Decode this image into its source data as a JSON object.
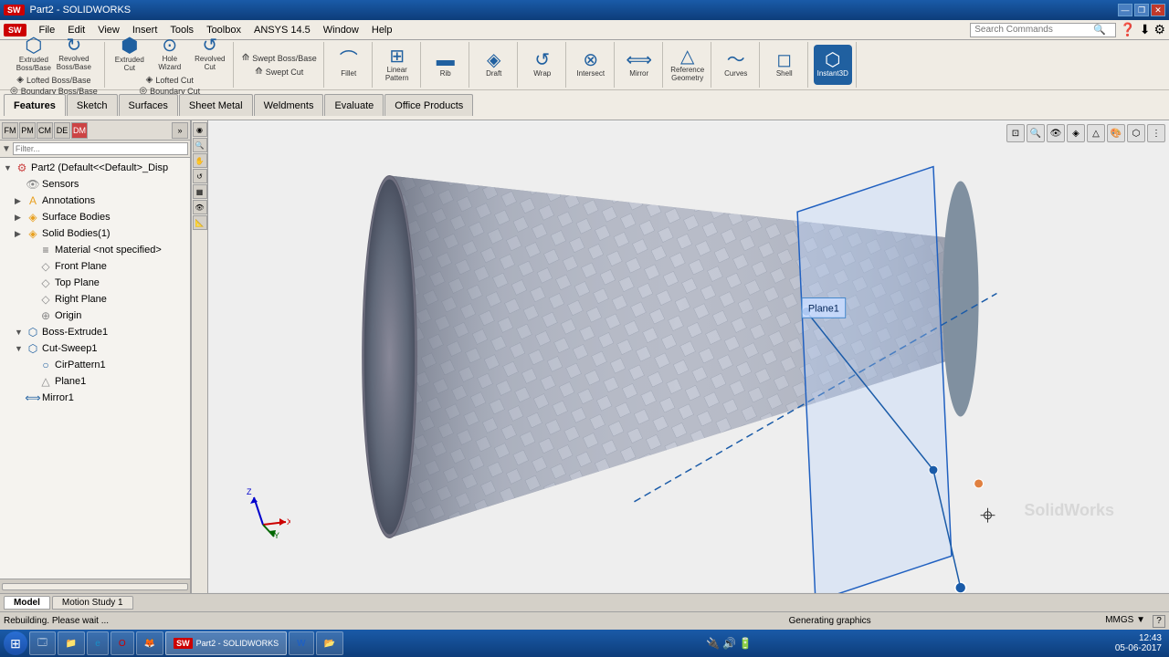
{
  "app": {
    "title": "Part2 - SOLIDWORKS",
    "logo": "SW"
  },
  "titlebar": {
    "title": "Part2 - SOLIDWORKS",
    "minimize": "—",
    "restore": "❐",
    "close": "✕"
  },
  "menubar": {
    "items": [
      "File",
      "Edit",
      "View",
      "Insert",
      "Tools",
      "Toolbox",
      "ANSYS 14.5",
      "Window",
      "Help"
    ],
    "search_placeholder": "Search Commands"
  },
  "toolbar": {
    "row1_groups": [
      {
        "name": "Extruded Boss/Base",
        "icon": "⬡",
        "sub_items": [
          "Revolved Boss/Base",
          "Lofted Boss/Base",
          "Boundary Boss/Base"
        ]
      },
      {
        "name": "Extruded Cut",
        "icon": "⬡",
        "sub_items": [
          "Hole Wizard",
          "Revolved Cut",
          "Lofted Cut",
          "Boundary Cut"
        ]
      },
      {
        "name": "Swept Boss/Base",
        "icon": "⬡",
        "sub_items": [
          "Swept Cut"
        ]
      },
      {
        "name": "Fillet",
        "icon": "⌒",
        "sub_items": []
      },
      {
        "name": "Linear Pattern",
        "icon": "⊞",
        "sub_items": []
      },
      {
        "name": "Rib",
        "icon": "▬",
        "sub_items": []
      },
      {
        "name": "Draft",
        "icon": "◈",
        "sub_items": []
      },
      {
        "name": "Wrap",
        "icon": "↺",
        "sub_items": []
      },
      {
        "name": "Intersect",
        "icon": "⊗",
        "sub_items": []
      },
      {
        "name": "Mirror",
        "icon": "⟺",
        "sub_items": []
      },
      {
        "name": "Reference Geometry",
        "icon": "△",
        "sub_items": []
      },
      {
        "name": "Curves",
        "icon": "~",
        "sub_items": []
      },
      {
        "name": "Shell",
        "icon": "◻",
        "sub_items": []
      },
      {
        "name": "Instant3D",
        "icon": "⬡",
        "sub_items": []
      }
    ],
    "tabs": [
      "Features",
      "Sketch",
      "Surfaces",
      "Sheet Metal",
      "Weldments",
      "Evaluate",
      "Office Products"
    ]
  },
  "sidebar": {
    "tree_items": [
      {
        "indent": 0,
        "expand": "",
        "icon": "⚙",
        "label": "Part2 (Default<<Default>_Disp",
        "level": 0
      },
      {
        "indent": 1,
        "expand": "",
        "icon": "👁",
        "label": "Sensors",
        "level": 1
      },
      {
        "indent": 1,
        "expand": "▶",
        "icon": "A",
        "label": "Annotations",
        "level": 1
      },
      {
        "indent": 1,
        "expand": "▶",
        "icon": "◈",
        "label": "Surface Bodies",
        "level": 1
      },
      {
        "indent": 1,
        "expand": "▶",
        "icon": "◈",
        "label": "Solid Bodies(1)",
        "level": 1
      },
      {
        "indent": 2,
        "expand": "",
        "icon": "≡",
        "label": "Material <not specified>",
        "level": 2
      },
      {
        "indent": 2,
        "expand": "",
        "icon": "◇",
        "label": "Front Plane",
        "level": 2
      },
      {
        "indent": 2,
        "expand": "",
        "icon": "◇",
        "label": "Top Plane",
        "level": 2
      },
      {
        "indent": 2,
        "expand": "",
        "icon": "◇",
        "label": "Right Plane",
        "level": 2
      },
      {
        "indent": 2,
        "expand": "",
        "icon": "⊕",
        "label": "Origin",
        "level": 2
      },
      {
        "indent": 1,
        "expand": "▼",
        "icon": "⬡",
        "label": "Boss-Extrude1",
        "level": 1
      },
      {
        "indent": 1,
        "expand": "▼",
        "icon": "⬡",
        "label": "Cut-Sweep1",
        "level": 1
      },
      {
        "indent": 2,
        "expand": "",
        "icon": "○",
        "label": "CirPattern1",
        "level": 2
      },
      {
        "indent": 2,
        "expand": "",
        "icon": "△",
        "label": "Plane1",
        "level": 2
      },
      {
        "indent": 1,
        "expand": "",
        "icon": "⟺",
        "label": "Mirror1",
        "level": 1
      }
    ]
  },
  "viewport": {
    "model_name": "Part2",
    "plane_label": "Plane1",
    "status": "Generating graphics"
  },
  "bottom_tabs": [
    "Model",
    "Motion Study 1"
  ],
  "statusbar": {
    "left": "Rebuilding. Please wait ...",
    "center": "Generating graphics",
    "right": "MMGS ▼",
    "help": "?"
  },
  "taskbar": {
    "start_icon": "⊞",
    "items": [
      {
        "icon": "🗔",
        "label": "File Explorer"
      },
      {
        "icon": "🌐",
        "label": "Internet Explorer"
      },
      {
        "icon": "○",
        "label": "Opera"
      },
      {
        "icon": "🔵",
        "label": "Firefox"
      },
      {
        "icon": "SW",
        "label": "SOLIDWORKS"
      },
      {
        "icon": "W",
        "label": "Word"
      },
      {
        "icon": "📁",
        "label": "Files"
      }
    ],
    "clock": "12:43",
    "date": "05-06-2017"
  },
  "icons": {
    "search": "🔍",
    "expand": "▶",
    "collapse": "▼",
    "close": "✕",
    "minimize": "—",
    "restore": "❐",
    "folder": "📁",
    "feature": "⬡",
    "plane": "◇",
    "origin": "⊕",
    "mirror": "⟺"
  }
}
